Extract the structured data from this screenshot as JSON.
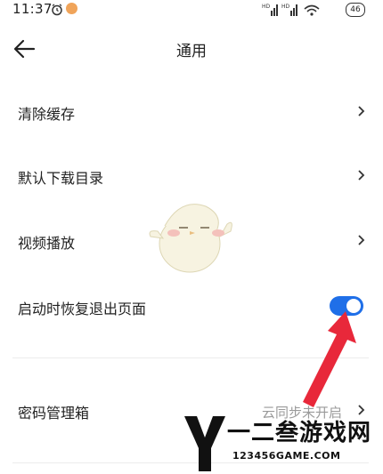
{
  "status_bar": {
    "time": "11:37",
    "battery": "46"
  },
  "header": {
    "title": "通用"
  },
  "settings": {
    "items": [
      {
        "label": "清除缓存"
      },
      {
        "label": "默认下载目录"
      },
      {
        "label": "视频播放"
      },
      {
        "label": "启动时恢复退出页面",
        "toggle_on": true
      },
      {
        "label": "密码管理箱",
        "value": "云同步未开启"
      }
    ]
  },
  "watermark": {
    "brand": "一二叁游戏网",
    "url": "123456GAME.COM"
  },
  "colors": {
    "toggle_active": "#1f6fe8",
    "annotation_arrow": "#e8283a"
  }
}
